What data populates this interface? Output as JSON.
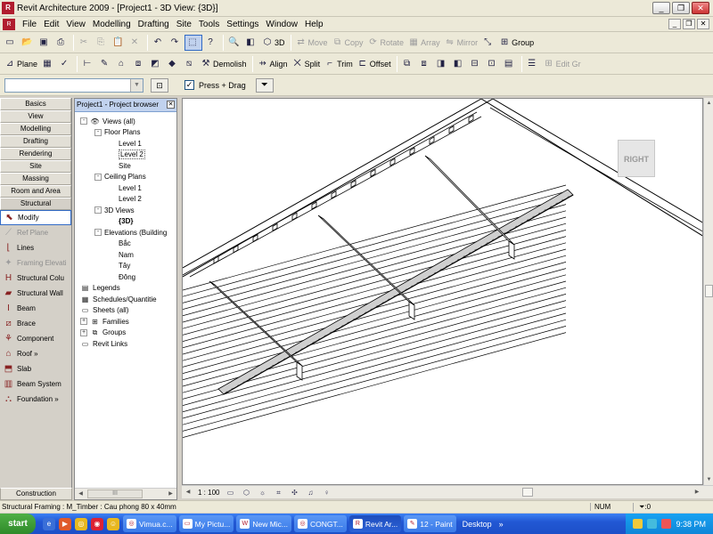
{
  "window": {
    "title": "Revit Architecture 2009 - [Project1 - 3D View: {3D}]",
    "app_icon": "R",
    "controls": [
      "minimize",
      "restore",
      "close"
    ]
  },
  "menu": {
    "items": [
      "File",
      "Edit",
      "View",
      "Modelling",
      "Drafting",
      "Site",
      "Tools",
      "Settings",
      "Window",
      "Help"
    ]
  },
  "toolbar1": {
    "move": "Move",
    "copy": "Copy",
    "rotate": "Rotate",
    "array": "Array",
    "mirror": "Mirror",
    "group": "Group",
    "view3d": "3D"
  },
  "toolbar2": {
    "plane": "Plane",
    "demolish": "Demolish",
    "align": "Align",
    "split": "Split",
    "trim": "Trim",
    "offset": "Offset",
    "edit": "Edit Gr"
  },
  "optionsbar": {
    "type_value": "",
    "press_drag": "Press + Drag",
    "press_drag_checked": true
  },
  "designbar": {
    "tabs": [
      "Basics",
      "View",
      "Modelling",
      "Drafting",
      "Rendering",
      "Site",
      "Massing",
      "Room and Area",
      "Structural"
    ],
    "tools": [
      {
        "label": "Modify",
        "icon": "pointer-icon",
        "state": "selected"
      },
      {
        "label": "Ref Plane",
        "icon": "ref-plane-icon",
        "state": "disabled"
      },
      {
        "label": "Lines",
        "icon": "lines-icon",
        "state": "normal"
      },
      {
        "label": "Framing Elevati",
        "icon": "framing-elevation-icon",
        "state": "disabled"
      },
      {
        "label": "Structural Colu",
        "icon": "column-icon",
        "state": "normal"
      },
      {
        "label": "Structural Wall",
        "icon": "wall-icon",
        "state": "normal"
      },
      {
        "label": "Beam",
        "icon": "beam-icon",
        "state": "normal"
      },
      {
        "label": "Brace",
        "icon": "brace-icon",
        "state": "normal"
      },
      {
        "label": "Component",
        "icon": "component-icon",
        "state": "normal"
      },
      {
        "label": "Roof »",
        "icon": "roof-icon",
        "state": "normal"
      },
      {
        "label": "Slab",
        "icon": "slab-icon",
        "state": "normal"
      },
      {
        "label": "Beam System",
        "icon": "beam-system-icon",
        "state": "normal"
      },
      {
        "label": "Foundation »",
        "icon": "foundation-icon",
        "state": "normal"
      }
    ],
    "bottom_tab": "Construction"
  },
  "browser": {
    "title": "Project1 - Project browser",
    "nodes": [
      {
        "label": "Views (all)",
        "depth": 0,
        "exp": "-",
        "icon": "views"
      },
      {
        "label": "Floor Plans",
        "depth": 1,
        "exp": "-"
      },
      {
        "label": "Level 1",
        "depth": 2
      },
      {
        "label": "Level 2",
        "depth": 2,
        "sel": true
      },
      {
        "label": "Site",
        "depth": 2
      },
      {
        "label": "Ceiling Plans",
        "depth": 1,
        "exp": "-"
      },
      {
        "label": "Level 1",
        "depth": 2
      },
      {
        "label": "Level 2",
        "depth": 2
      },
      {
        "label": "3D Views",
        "depth": 1,
        "exp": "-"
      },
      {
        "label": "{3D}",
        "depth": 2,
        "bold": true
      },
      {
        "label": "Elevations (Building",
        "depth": 1,
        "exp": "-"
      },
      {
        "label": "Bắc",
        "depth": 2
      },
      {
        "label": "Nam",
        "depth": 2
      },
      {
        "label": "Tây",
        "depth": 2
      },
      {
        "label": "Đông",
        "depth": 2
      },
      {
        "label": "Legends",
        "depth": 0,
        "icon": "legend"
      },
      {
        "label": "Schedules/Quantitie",
        "depth": 0,
        "icon": "schedule"
      },
      {
        "label": "Sheets (all)",
        "depth": 0,
        "icon": "sheet"
      },
      {
        "label": "Families",
        "depth": 0,
        "exp": "+",
        "icon": "family"
      },
      {
        "label": "Groups",
        "depth": 0,
        "exp": "+",
        "icon": "group"
      },
      {
        "label": "Revit Links",
        "depth": 0,
        "icon": "link"
      }
    ]
  },
  "view": {
    "cube_label": "RIGHT",
    "scale": "1 : 100"
  },
  "statusbar": {
    "message": "Structural Framing : M_Timber : Cau phong 80 x 40mm",
    "num": "NUM",
    "filter": ":0"
  },
  "taskbar": {
    "start": "start",
    "tasks": [
      {
        "label": "Vimua.c...",
        "icon": "browser-icon"
      },
      {
        "label": "My Pictu...",
        "icon": "folder-icon"
      },
      {
        "label": "New Mic...",
        "icon": "word-icon"
      },
      {
        "label": "CONGT...",
        "icon": "browser-icon"
      },
      {
        "label": "Revit Ar...",
        "icon": "revit-icon",
        "active": true
      },
      {
        "label": "12 - Paint",
        "icon": "paint-icon"
      }
    ],
    "desktop": "Desktop",
    "time": "9:38 PM"
  }
}
